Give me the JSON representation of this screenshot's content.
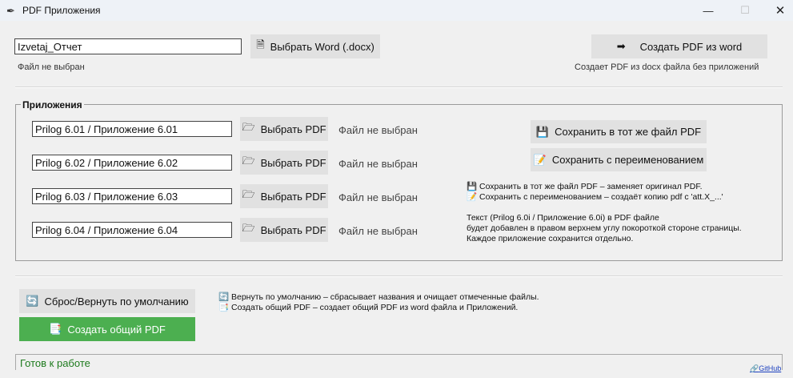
{
  "window": {
    "title": "PDF Приложения",
    "icons": {
      "app": "feather-icon",
      "minimize": "minimize-icon",
      "maximize": "maximize-icon",
      "close": "close-icon"
    }
  },
  "top": {
    "word_entry_value": "Izvetaj_Отчет",
    "choose_word_label": "Выбрать Word (.docx)",
    "word_status": "Файл не выбран",
    "create_pdf_label": "Создать PDF из word",
    "create_pdf_hint": "Создает PDF из docx файла без приложений"
  },
  "attachments": {
    "title": "Приложения",
    "rows": [
      {
        "name": "Prilog 6.01 / Приложение 6.01",
        "button": "Выбрать PDF",
        "status": "Файл не выбран"
      },
      {
        "name": "Prilog 6.02 / Приложение 6.02",
        "button": "Выбрать PDF",
        "status": "Файл не выбран"
      },
      {
        "name": "Prilog 6.03 / Приложение 6.03",
        "button": "Выбрать PDF",
        "status": "Файл не выбран"
      },
      {
        "name": "Prilog 6.04 / Приложение 6.04",
        "button": "Выбрать PDF",
        "status": "Файл не выбран"
      }
    ],
    "save_same_label": "Сохранить в тот же файл PDF",
    "save_rename_label": "Сохранить с переименованием",
    "help_lines": [
      "💾 Сохранить в тот же файл PDF – заменяет оригинал PDF.",
      "📝 Сохранить с переименованием – создаёт копию pdf с 'att.X_...'"
    ],
    "info_lines": [
      "Текст (Prilog 6.0i / Приложение 6.0i) в PDF файле",
      "будет добавлен в правом верхнем углу покороткой стороне страницы.",
      "Каждое приложение сохранится отдельно."
    ]
  },
  "bottom": {
    "reset_label": "Сброс/Вернуть по умолчанию",
    "create_combined_label": "Создать общий PDF",
    "help_lines": [
      "🔄 Вернуть по умолчанию – сбрасывает названия и очищает отмеченные файлы.",
      "📑 Создать общий PDF – создает общий PDF из word файла и Приложений."
    ]
  },
  "status_bar": {
    "text": "Готов к работе",
    "github_label": "GitHub"
  },
  "colors": {
    "accent_green": "#4caf50",
    "status_green": "#1e7b1e",
    "button_gray": "#e1e1e1"
  }
}
